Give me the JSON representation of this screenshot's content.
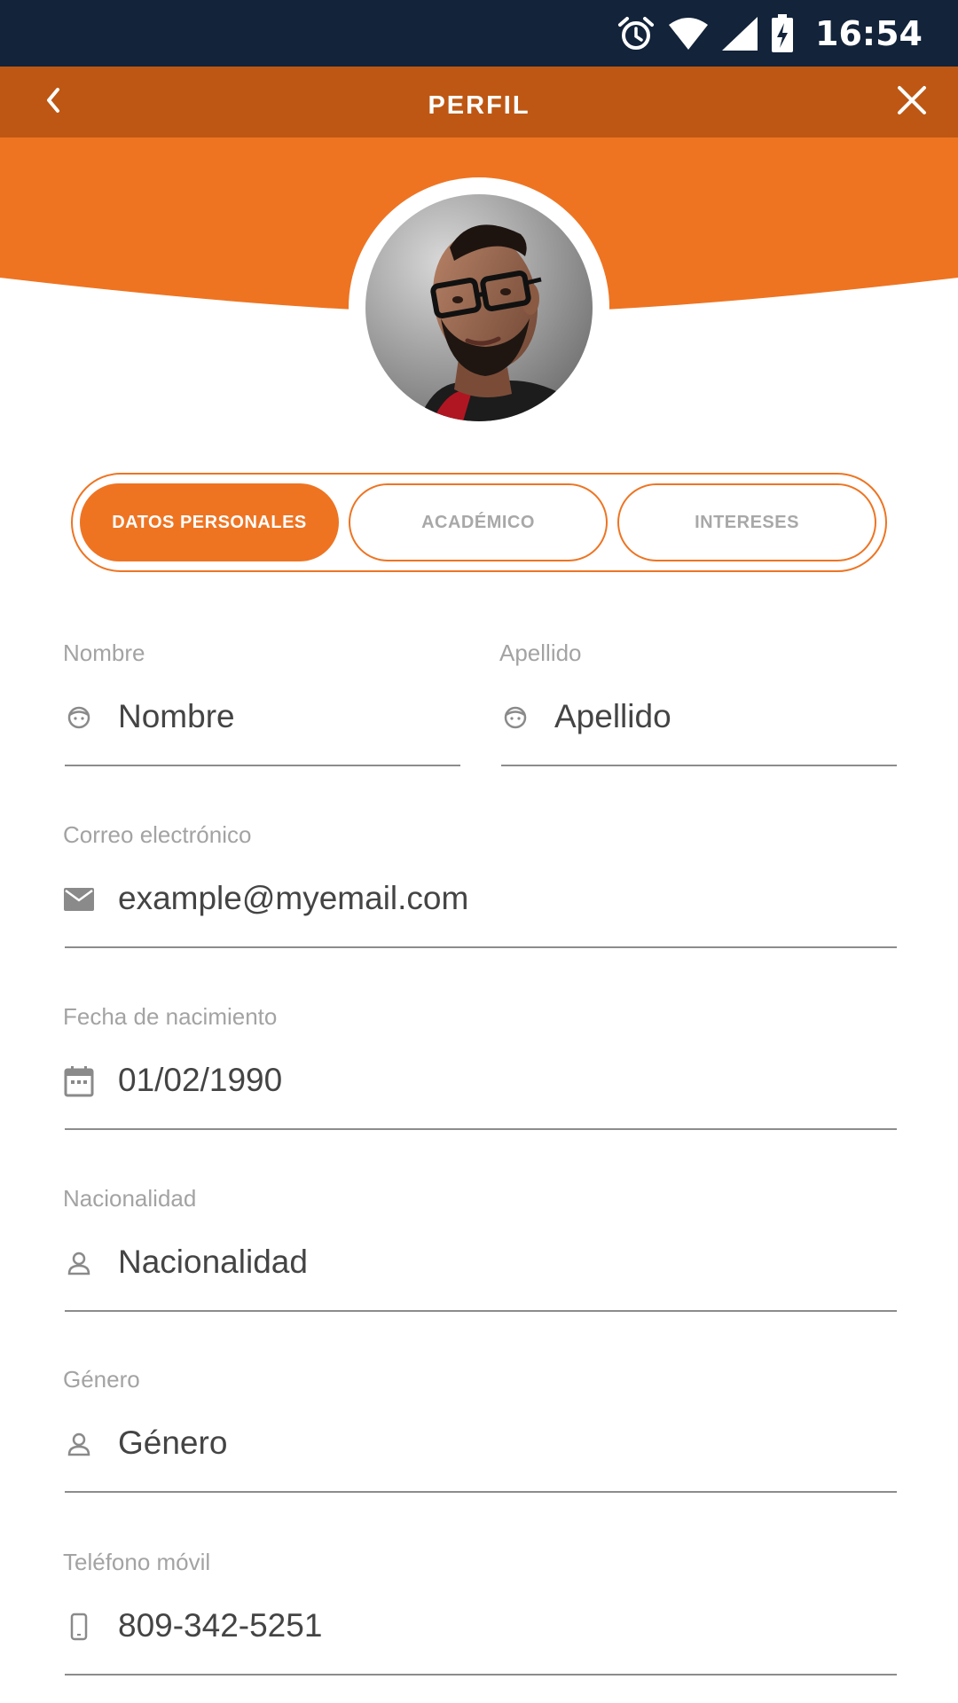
{
  "status_bar": {
    "time": "16:54",
    "icons": [
      "alarm-icon",
      "wifi-icon",
      "signal-icon",
      "battery-charging-icon"
    ]
  },
  "app_bar": {
    "title": "PERFIL",
    "back_icon": "chevron-left-icon",
    "close_icon": "close-icon"
  },
  "colors": {
    "status_bar": "#12233a",
    "app_bar": "#bd5713",
    "accent": "#ee7422",
    "label": "#a3a3a3",
    "value": "#444444"
  },
  "tabs": [
    {
      "label": "DATOS PERSONALES",
      "active": true
    },
    {
      "label": "ACADÉMICO",
      "active": false
    },
    {
      "label": "INTERESES",
      "active": false
    }
  ],
  "form": {
    "nombre": {
      "label": "Nombre",
      "value": "Nombre",
      "icon": "face-icon"
    },
    "apellido": {
      "label": "Apellido",
      "value": "Apellido",
      "icon": "face-icon"
    },
    "correo": {
      "label": "Correo electrónico",
      "value": "example@myemail.com",
      "icon": "email-icon"
    },
    "fecha": {
      "label": "Fecha de nacimiento",
      "value": "01/02/1990",
      "icon": "calendar-icon"
    },
    "nacionalidad": {
      "label": "Nacionalidad",
      "value": "Nacionalidad",
      "icon": "person-icon"
    },
    "genero": {
      "label": "Género",
      "value": "Género",
      "icon": "person-icon"
    },
    "telefono": {
      "label": "Teléfono móvil",
      "value": "809-342-5251",
      "icon": "phone-icon"
    }
  }
}
